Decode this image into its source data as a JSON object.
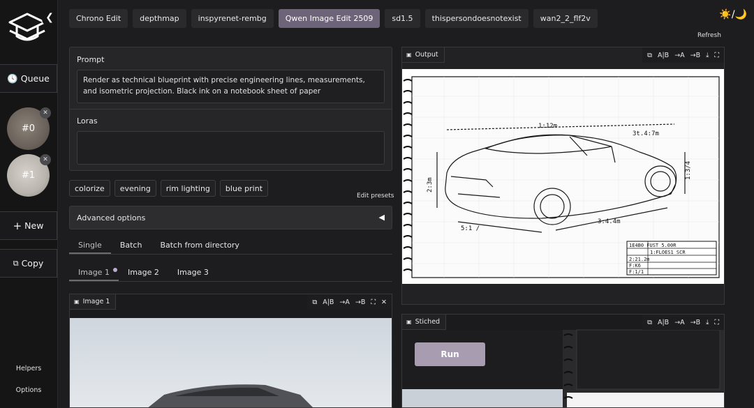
{
  "sidebar": {
    "queue_label": "Queue",
    "queue_items": [
      {
        "label": "#0"
      },
      {
        "label": "#1"
      }
    ],
    "new_label": "New",
    "copy_label": "Copy",
    "helpers_label": "Helpers",
    "options_label": "Options"
  },
  "tabs": [
    {
      "label": "Chrono Edit"
    },
    {
      "label": "depthmap"
    },
    {
      "label": "inspyrenet-rembg"
    },
    {
      "label": "Qwen Image Edit 2509"
    },
    {
      "label": "sd1.5"
    },
    {
      "label": "thispersondoesnotexist"
    },
    {
      "label": "wan2_2_flf2v"
    }
  ],
  "header": {
    "theme_toggle": "☀️/🌙",
    "refresh_label": "Refresh"
  },
  "prompt": {
    "label": "Prompt",
    "value": "Render as technical blueprint with precise engineering lines, measurements, and isometric projection. Black ink on a notebook sheet of paper"
  },
  "loras": {
    "label": "Loras",
    "value": ""
  },
  "presets": [
    "colorize",
    "evening",
    "rim lighting",
    "blue print"
  ],
  "edit_presets_label": "Edit presets",
  "advanced_label": "Advanced options",
  "mode_tabs": [
    "Single",
    "Batch",
    "Batch from directory"
  ],
  "image_tabs": [
    "Image 1",
    "Image 2",
    "Image 3"
  ],
  "image1_label": "Image 1",
  "output_label": "Output",
  "stiched_label": "Stiched",
  "run_label": "Run",
  "tools": {
    "swap": "A|B",
    "to_a": "→A",
    "to_b": "→B"
  },
  "blueprint": {
    "dim_top": "1:12m",
    "dim_right": "3t.4:7m",
    "dim_height": "2:3m",
    "dim_side": "1:3/4",
    "dim_bottom_left": "5:1 /",
    "dim_bottom_right": "3:4.4m",
    "title_rows": [
      "1E4B0  FUST 5.00R",
      "1:FLOES1 SCR",
      "2:21.2m",
      "F:K6",
      "F:1/1"
    ]
  }
}
